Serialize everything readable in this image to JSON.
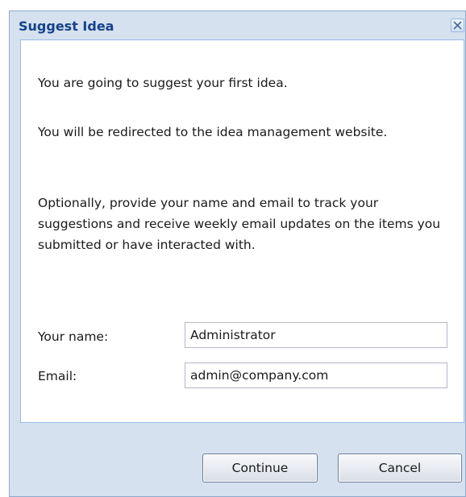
{
  "dialog": {
    "title": "Suggest Idea",
    "close_icon": "close-icon"
  },
  "body": {
    "paragraph_1": "You are going to suggest your first idea.",
    "paragraph_2": "You will be redirected to the idea management website.",
    "paragraph_3": "Optionally, provide your name and email to track your suggestions and receive weekly email updates on the items you submitted or have interacted with."
  },
  "form": {
    "name_label": "Your name:",
    "name_value": "Administrator",
    "email_label": "Email:",
    "email_value": "admin@company.com"
  },
  "buttons": {
    "continue_label": "Continue",
    "cancel_label": "Cancel"
  },
  "colors": {
    "title_text": "#15428b",
    "frame_background": "#d5e1ef",
    "frame_border": "#99bbe8"
  }
}
